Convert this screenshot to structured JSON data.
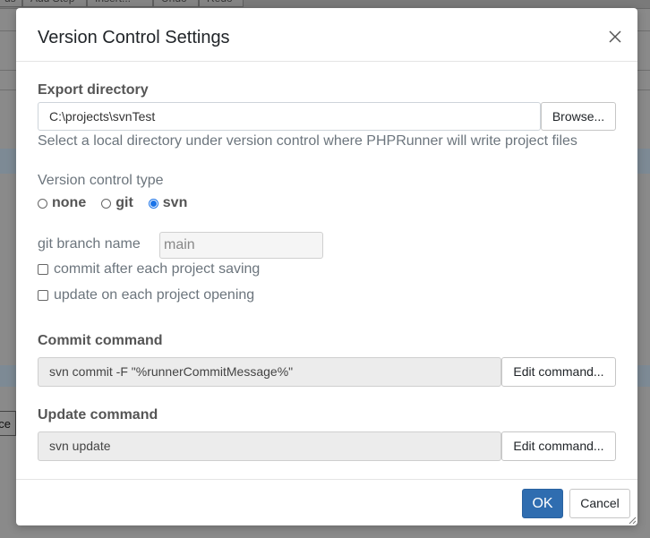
{
  "background": {
    "toolbar_buttons": [
      "ds",
      "Add Step",
      "Insert...",
      "Undo",
      "Redo"
    ],
    "left_stub_text": "nce"
  },
  "dialog": {
    "title": "Version Control Settings",
    "export_directory": {
      "label": "Export directory",
      "value": "C:\\projects\\svnTest",
      "browse_label": "Browse...",
      "help": "Select a local directory under version control where PHPRunner will write project files"
    },
    "vc_type": {
      "label": "Version control type",
      "options": [
        "none",
        "git",
        "svn"
      ],
      "selected": "svn"
    },
    "git_branch": {
      "label": "git branch name",
      "value": "main"
    },
    "checkboxes": [
      {
        "label": "commit after each project saving",
        "checked": false
      },
      {
        "label": "update on each project opening",
        "checked": false
      }
    ],
    "commit": {
      "label": "Commit command",
      "value": "svn commit -F \"%runnerCommitMessage%\"",
      "edit_label": "Edit command..."
    },
    "update": {
      "label": "Update command",
      "value": "svn update",
      "edit_label": "Edit command..."
    },
    "ok_label": "OK",
    "cancel_label": "Cancel",
    "accent_color": "#2f6db0"
  }
}
